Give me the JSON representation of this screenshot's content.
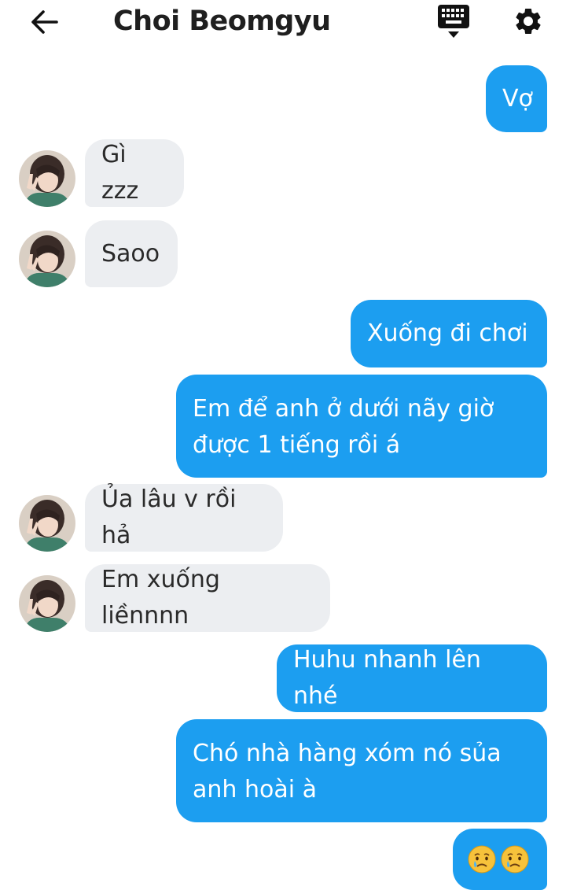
{
  "header": {
    "title": "Choi Beomgyu",
    "back_icon": "arrow-left-icon",
    "keyboard_icon": "keyboard-icon",
    "settings_icon": "gear-icon"
  },
  "colors": {
    "outgoing_bubble": "#1c9ef0",
    "incoming_bubble": "#eceef1",
    "outgoing_text": "#ffffff",
    "incoming_text": "#2a2a2a"
  },
  "messages": [
    {
      "direction": "out",
      "text": "Vợ"
    },
    {
      "direction": "in",
      "text": "Gì zzz"
    },
    {
      "direction": "in",
      "text": "Saoo"
    },
    {
      "direction": "out",
      "text": "Xuống đi chơi"
    },
    {
      "direction": "out",
      "text": "Em để anh ở dưới nãy giờ\nđược 1 tiếng rồi á"
    },
    {
      "direction": "in",
      "text": "Ủa lâu v rồi hả"
    },
    {
      "direction": "in",
      "text": "Em xuống liềnnnn"
    },
    {
      "direction": "out",
      "text": "Huhu nhanh lên nhé"
    },
    {
      "direction": "out",
      "text": "Chó nhà hàng xóm nó sủa\nanh hoài à"
    },
    {
      "direction": "out",
      "text": "",
      "icons": [
        "crying-face-icon",
        "crying-face-icon"
      ]
    }
  ]
}
